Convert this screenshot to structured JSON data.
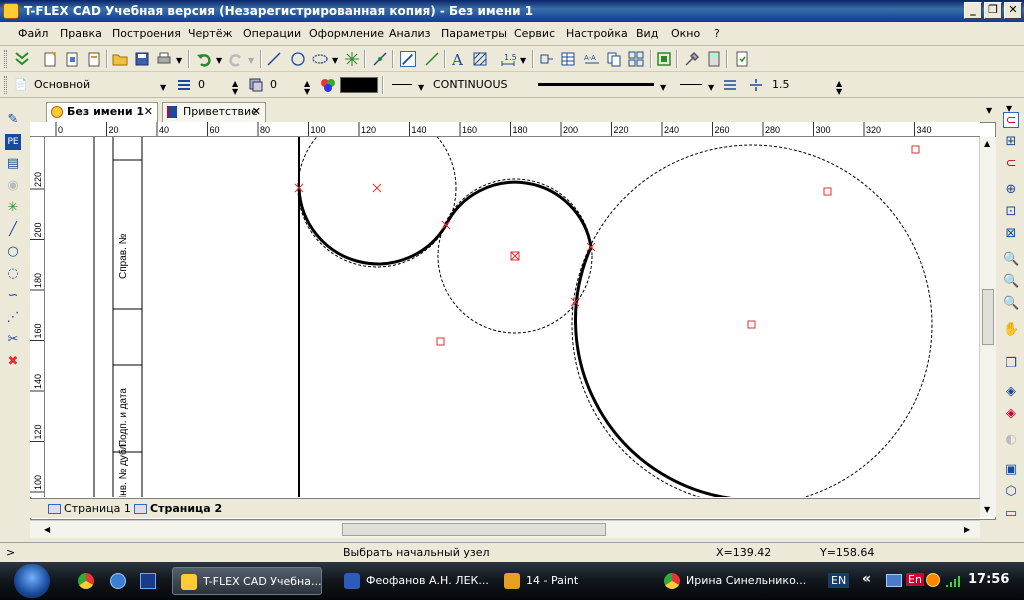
{
  "window": {
    "title": "T-FLEX CAD Учебная версия (Незарегистрированная копия) - Без имени 1",
    "min_label": "_",
    "max_label": "❐",
    "close_label": "✕"
  },
  "menu": [
    "Файл",
    "Правка",
    "Построения",
    "Чертёж",
    "Операции",
    "Оформление",
    "Анализ",
    "Параметры",
    "Сервис",
    "Настройка",
    "Вид",
    "Окно",
    "?"
  ],
  "props_bar": {
    "layer": "Основной",
    "level1": "0",
    "level2": "0",
    "linetype": "CONTINUOUS",
    "linewidth": "1.5",
    "color": "#000000"
  },
  "doc_tabs": [
    {
      "label": "Без имени 1",
      "active": true,
      "close": "✕"
    },
    {
      "label": "Приветствие",
      "active": false,
      "close": "✕"
    }
  ],
  "ruler": {
    "h_ticks": [
      "0",
      "20",
      "40",
      "60",
      "80",
      "100",
      "120",
      "140",
      "160",
      "180",
      "200",
      "220",
      "240",
      "260",
      "280",
      "300",
      "320",
      "340"
    ],
    "v_ticks": [
      "220",
      "200",
      "180",
      "160",
      "140",
      "120",
      "100"
    ]
  },
  "title_block": {
    "cell1": "Справ. №",
    "cell2": "Подп. и дата",
    "cell3": "Инв. № дубл."
  },
  "page_tabs": [
    {
      "label": "Страница 1",
      "active": false
    },
    {
      "label": "Страница 2",
      "active": true
    }
  ],
  "status": {
    "prompt_marker": ">",
    "message": "Выбрать начальный узел",
    "x": "X=139.42",
    "y": "Y=158.64"
  },
  "taskbar": {
    "items": [
      {
        "label": "T-FLEX CAD Учебна...",
        "active": true
      },
      {
        "label": "Феофанов А.Н. ЛЕК...",
        "active": false
      },
      {
        "label": "14 - Paint",
        "active": false
      },
      {
        "label": "Ирина Синельнико...",
        "active": false
      }
    ],
    "lang": "EN",
    "lang2": "En",
    "clock": "17:56",
    "chevron": "«"
  },
  "colors": {
    "accent_red": "#e03030",
    "title_blue": "#0a246a"
  },
  "icons": [
    "new-icon",
    "open-icon",
    "save-icon",
    "print-icon",
    "undo-icon",
    "redo-icon",
    "line-icon",
    "circle-icon",
    "snap-icon",
    "text-icon",
    "hatch-icon",
    "dimension-icon",
    "zoom-in-icon",
    "zoom-window-icon",
    "delete-icon"
  ]
}
